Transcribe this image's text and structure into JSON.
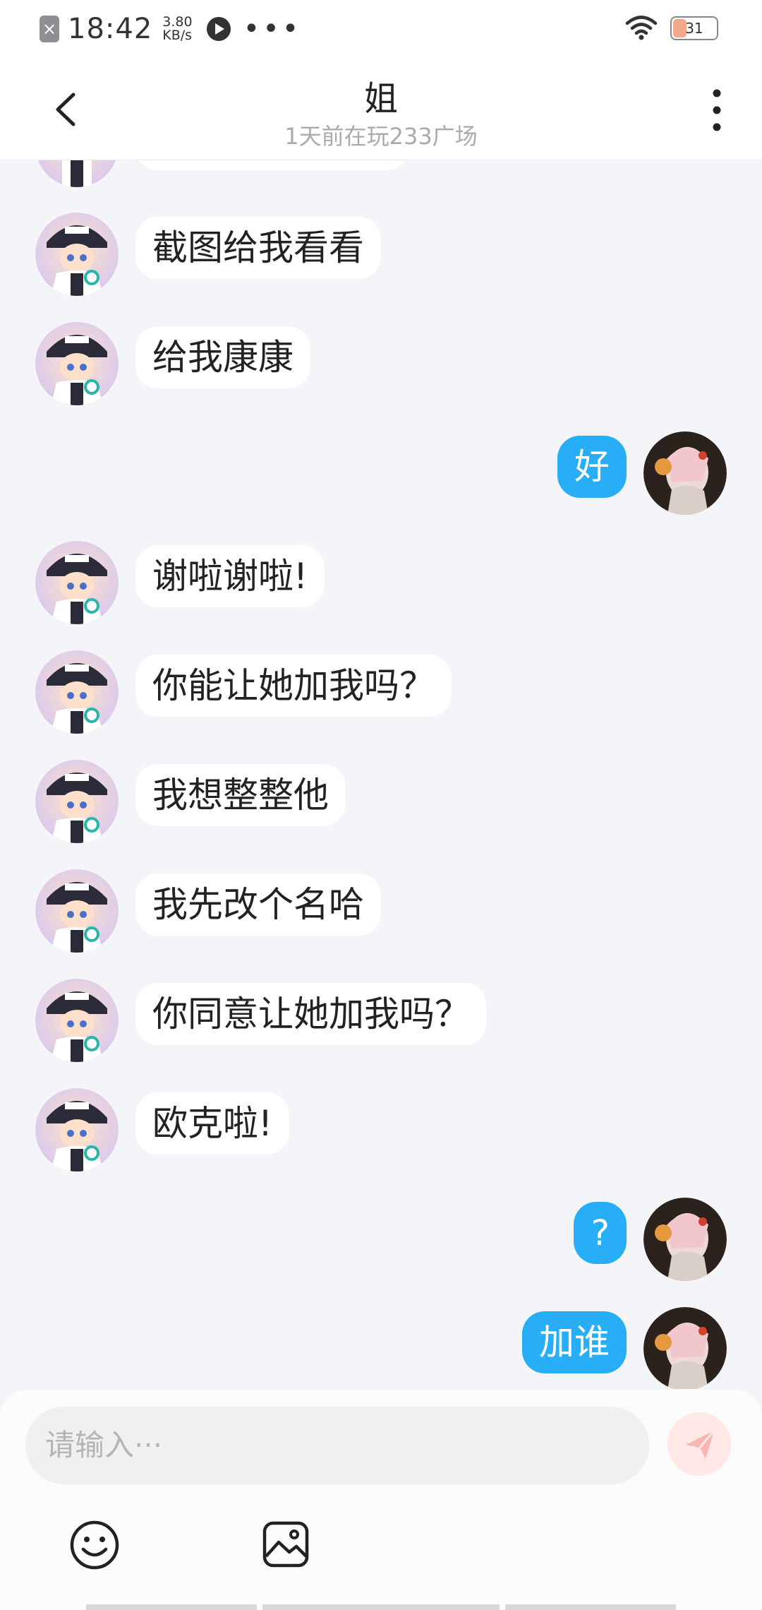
{
  "status_bar": {
    "time": "18:42",
    "speed_value": "3.80",
    "speed_unit": "KB/s",
    "battery": "31",
    "icons": [
      "x-notification-icon",
      "play-icon",
      "more-dots-icon",
      "wifi-icon",
      "battery-icon"
    ]
  },
  "header": {
    "title": "姐",
    "subtitle": "1天前在玩233广场",
    "icons": [
      "back-arrow-icon",
      "more-vertical-icon"
    ]
  },
  "messages": [
    {
      "side": "left",
      "text": "截图给我看看"
    },
    {
      "side": "left",
      "text": "给我康康"
    },
    {
      "side": "right",
      "text": "好"
    },
    {
      "side": "left",
      "text": "谢啦谢啦!"
    },
    {
      "side": "left",
      "text": "你能让她加我吗？"
    },
    {
      "side": "left",
      "text": "我想整整他"
    },
    {
      "side": "left",
      "text": "我先改个名哈"
    },
    {
      "side": "left",
      "text": "你同意让她加我吗？"
    },
    {
      "side": "left",
      "text": "欧克啦!"
    },
    {
      "side": "right",
      "text": "?"
    },
    {
      "side": "right",
      "text": "加谁"
    }
  ],
  "composer": {
    "placeholder": "请输入···",
    "icons": [
      "send-icon",
      "emoji-icon",
      "image-icon"
    ]
  },
  "colors": {
    "accent_blue": "#28aef7",
    "background": "#f3f5f8",
    "send_disabled": "#ffe8e6",
    "send_icon": "#fbb5b0"
  }
}
